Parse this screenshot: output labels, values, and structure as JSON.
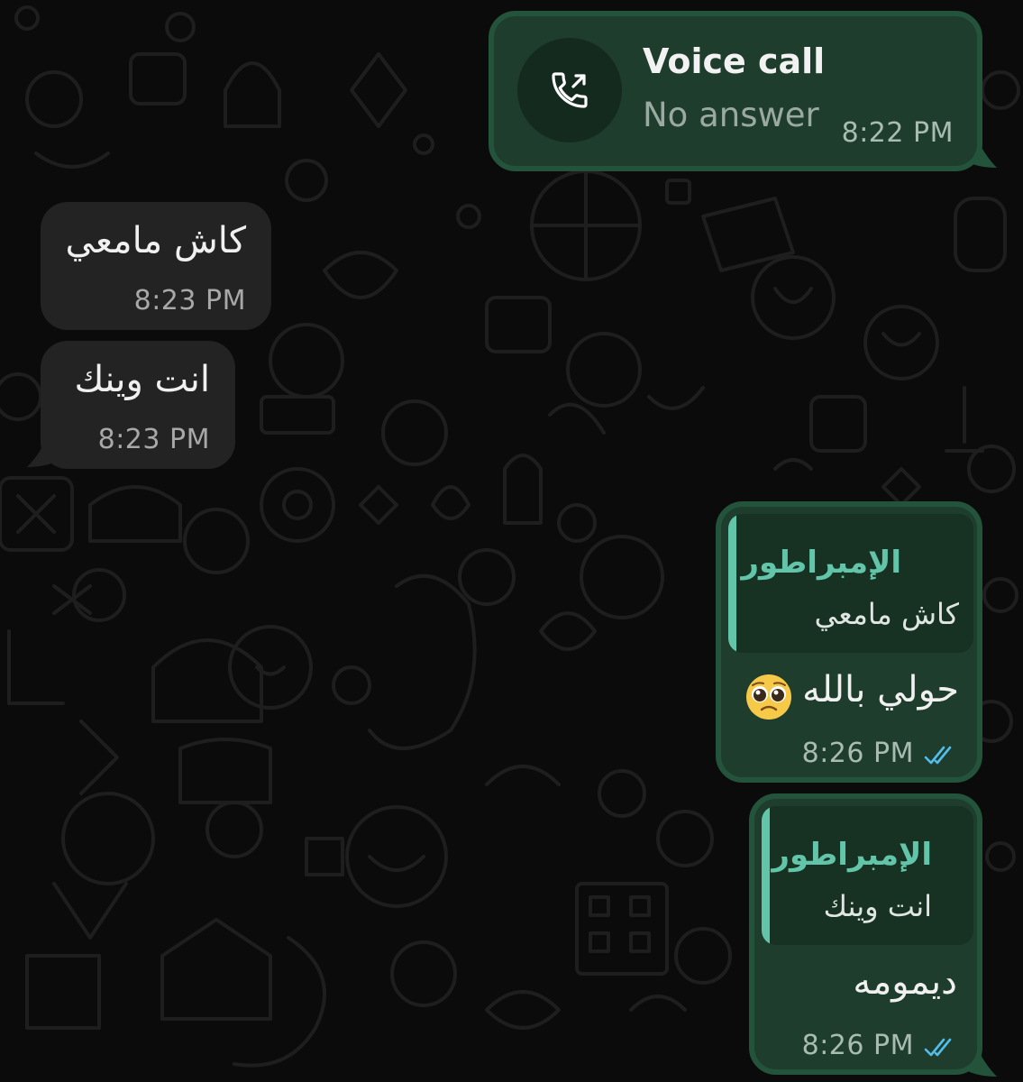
{
  "colors": {
    "background": "#0b0b0b",
    "incoming_bubble": "#232323",
    "outgoing_bubble": "#1e3d2d",
    "outgoing_border": "#23543b",
    "quote_accent": "#62c5a9",
    "read_ticks": "#53bdeb"
  },
  "messages": {
    "call": {
      "icon": "outgoing-call-icon",
      "title": "Voice call",
      "status": "No answer",
      "time": "8:22 PM"
    },
    "incoming_1": {
      "text": "كاش مامعي",
      "time": "8:23 PM"
    },
    "incoming_2": {
      "text": "انت وينك",
      "time": "8:23 PM"
    },
    "outgoing_1": {
      "quote_name": "الإمبراطور",
      "quote_text": "كاش مامعي",
      "text": "حولي بالله",
      "emoji": "pleading-face-emoji",
      "time": "8:26 PM",
      "status_icon": "double-check-read-icon"
    },
    "outgoing_2": {
      "quote_name": "الإمبراطور",
      "quote_text": "انت وينك",
      "text": "ديمومه",
      "time": "8:26 PM",
      "status_icon": "double-check-read-icon"
    }
  }
}
